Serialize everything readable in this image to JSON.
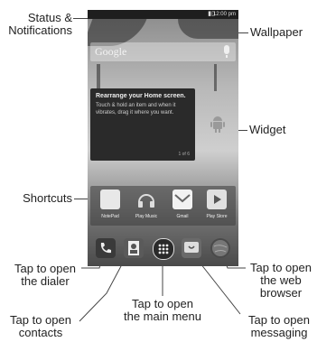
{
  "callouts": {
    "status": [
      "Status &",
      "Notifications"
    ],
    "wallpaper": "Wallpaper",
    "widget": "Widget",
    "shortcuts": "Shortcuts",
    "dialer": [
      "Tap to open",
      "the dialer"
    ],
    "main_menu": [
      "Tap to open",
      "the main menu"
    ],
    "contacts": [
      "Tap to open",
      "contacts"
    ],
    "browser": [
      "Tap to open",
      "the web",
      "browser"
    ],
    "messaging": [
      "Tap to open",
      "messaging"
    ]
  },
  "statusbar": {
    "time": "12:00 pm"
  },
  "search": {
    "brand": "Google"
  },
  "widget_card": {
    "title": "Rearrange your Home screen.",
    "body": "Touch & hold an item and when it vibrates, drag it where you want.",
    "page": "1 of 6"
  },
  "shortcuts": [
    {
      "label": "NotePad",
      "icon": "notepad-icon",
      "color": "#e8e8e8"
    },
    {
      "label": "Play Music",
      "icon": "headphones-icon",
      "color": "#cfcfcf"
    },
    {
      "label": "Gmail",
      "icon": "gmail-icon",
      "color": "#f2f2f2"
    },
    {
      "label": "Play Store",
      "icon": "play-store-icon",
      "color": "#e0e0e0"
    }
  ],
  "dock": [
    {
      "name": "phone-icon",
      "color": "#3a3a3a"
    },
    {
      "name": "contacts-icon",
      "color": "#5a5a5a"
    },
    {
      "name": "apps-icon",
      "color": "#2a2a2a"
    },
    {
      "name": "messaging-icon",
      "color": "#6a6a6a"
    },
    {
      "name": "browser-icon",
      "color": "#4a4a4a"
    }
  ]
}
